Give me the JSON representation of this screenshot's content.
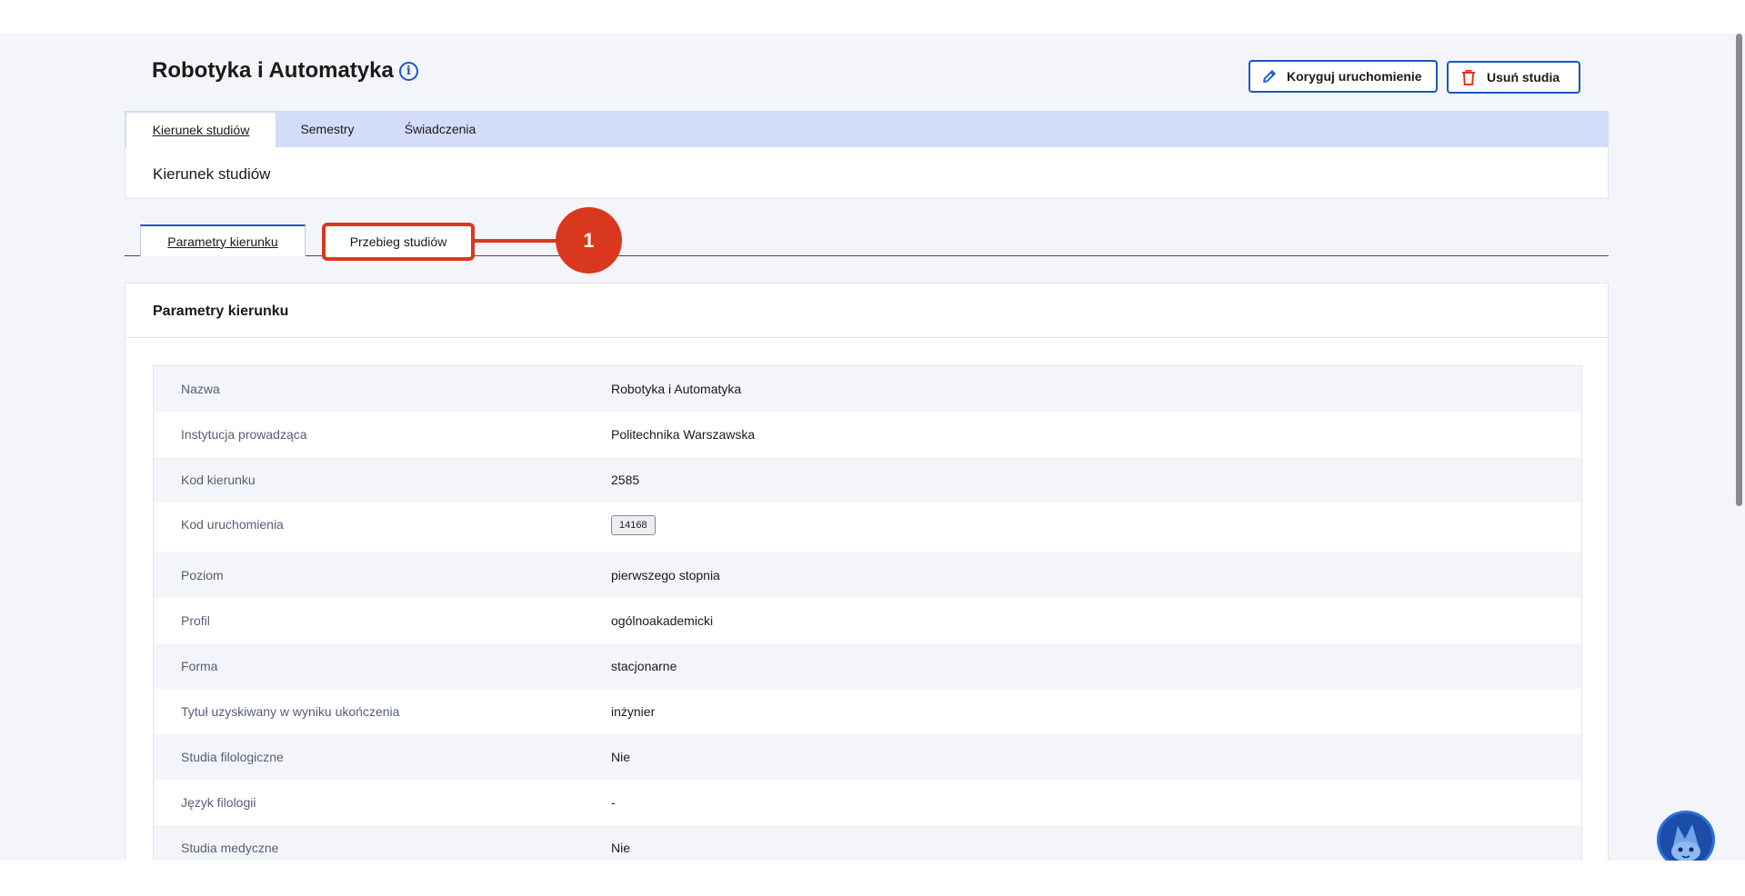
{
  "header": {
    "title": "Robotyka i Automatyka",
    "info_icon": "info-circle-icon",
    "edit_button": "Koryguj uruchomienie",
    "delete_button": "Usuń studia"
  },
  "tabs": [
    {
      "label": "Kierunek studiów",
      "active": true
    },
    {
      "label": "Semestry",
      "active": false
    },
    {
      "label": "Świadczenia",
      "active": false
    }
  ],
  "section": {
    "title": "Kierunek studiów"
  },
  "subtabs": [
    {
      "label": "Parametry kierunku",
      "active": true
    },
    {
      "label": "Przebieg studiów",
      "active": false
    }
  ],
  "callout": {
    "number": "1"
  },
  "params": {
    "title": "Parametry kierunku",
    "rows": [
      {
        "label": "Nazwa",
        "value": "Robotyka i Automatyka"
      },
      {
        "label": "Instytucja prowadząca",
        "value": "Politechnika Warszawska"
      },
      {
        "label": "Kod kierunku",
        "value": "2585"
      },
      {
        "label": "Kod uruchomienia",
        "value": "14168"
      },
      {
        "label": "Poziom",
        "value": "pierwszego stopnia"
      },
      {
        "label": "Profil",
        "value": "ogólnoakademicki"
      },
      {
        "label": "Forma",
        "value": "stacjonarne"
      },
      {
        "label": "Tytuł uzyskiwany w wyniku ukończenia",
        "value": "inżynier"
      },
      {
        "label": "Studia filologiczne",
        "value": "Nie"
      },
      {
        "label": "Język filologii",
        "value": "-"
      },
      {
        "label": "Studia medyczne",
        "value": "Nie"
      }
    ]
  },
  "colors": {
    "accent": "#1a57c2",
    "highlight": "#d9381e",
    "tab_bar": "#d3dcf8",
    "background": "#f4f5fa"
  }
}
